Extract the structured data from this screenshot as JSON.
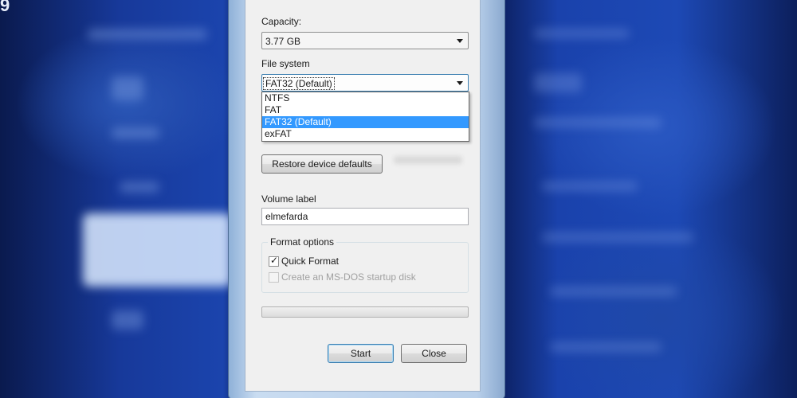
{
  "capacity": {
    "label": "Capacity:",
    "value": "3.77 GB"
  },
  "file_system": {
    "label": "File system",
    "value": "FAT32 (Default)",
    "options": [
      "NTFS",
      "FAT",
      "FAT32 (Default)",
      "exFAT"
    ],
    "selected_index": 2
  },
  "restore_defaults_label": "Restore device defaults",
  "volume_label": {
    "label": "Volume label",
    "value": "elmefarda"
  },
  "format_options": {
    "title": "Format options",
    "quick_format": {
      "label": "Quick Format",
      "checked": true,
      "enabled": true
    },
    "msdos_disk": {
      "label": "Create an MS-DOS startup disk",
      "checked": false,
      "enabled": false
    }
  },
  "progress": {
    "fraction": 0
  },
  "buttons": {
    "start": "Start",
    "close": "Close"
  },
  "colors": {
    "selection": "#3399ff",
    "focus_border": "#3c7fb1",
    "desktop": "#1b44ad"
  }
}
